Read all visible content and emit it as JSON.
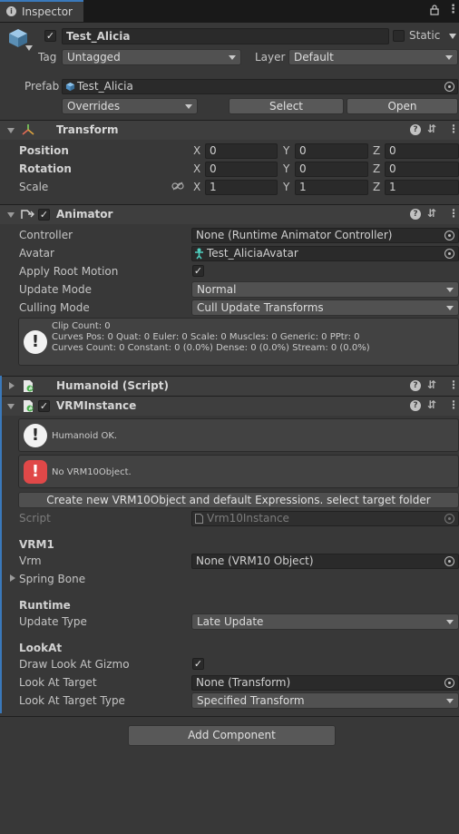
{
  "tab": {
    "title": "Inspector"
  },
  "object": {
    "name": "Test_Alicia",
    "static_label": "Static",
    "tag_label": "Tag",
    "tag_value": "Untagged",
    "layer_label": "Layer",
    "layer_value": "Default",
    "prefab_label": "Prefab",
    "prefab_value": "Test_Alicia",
    "overrides_label": "Overrides",
    "select_label": "Select",
    "open_label": "Open"
  },
  "transform": {
    "title": "Transform",
    "position_label": "Position",
    "rotation_label": "Rotation",
    "scale_label": "Scale",
    "axis_x": "X",
    "axis_y": "Y",
    "axis_z": "Z",
    "position": [
      "0",
      "0",
      "0"
    ],
    "rotation": [
      "0",
      "0",
      "0"
    ],
    "scale": [
      "1",
      "1",
      "1"
    ]
  },
  "animator": {
    "title": "Animator",
    "controller_label": "Controller",
    "controller_value": "None (Runtime Animator Controller)",
    "avatar_label": "Avatar",
    "avatar_value": "Test_AliciaAvatar",
    "root_motion_label": "Apply Root Motion",
    "update_mode_label": "Update Mode",
    "update_mode_value": "Normal",
    "culling_mode_label": "Culling Mode",
    "culling_mode_value": "Cull Update Transforms",
    "info_lines": [
      "Clip Count: 0",
      "Curves Pos: 0 Quat: 0 Euler: 0 Scale: 0 Muscles: 0 Generic: 0 PPtr: 0",
      "Curves Count: 0 Constant: 0 (0.0%) Dense: 0 (0.0%) Stream: 0 (0.0%)"
    ]
  },
  "humanoid": {
    "title": "Humanoid (Script)"
  },
  "vrm": {
    "title": "VRMInstance",
    "humanoid_ok": "Humanoid OK.",
    "no_object": "No VRM10Object.",
    "create_button": "Create new VRM10Object and default Expressions. select target folder",
    "script_label": "Script",
    "script_value": "Vrm10Instance",
    "vrm1_header": "VRM1",
    "vrm_label": "Vrm",
    "vrm_value": "None (VRM10 Object)",
    "spring_bone_label": "Spring Bone",
    "runtime_header": "Runtime",
    "update_type_label": "Update Type",
    "update_type_value": "Late Update",
    "lookat_header": "LookAt",
    "draw_gizmo_label": "Draw Look At Gizmo",
    "target_label": "Look At Target",
    "target_value": "None (Transform)",
    "target_type_label": "Look At Target Type",
    "target_type_value": "Specified Transform"
  },
  "footer": {
    "add_component": "Add Component"
  }
}
